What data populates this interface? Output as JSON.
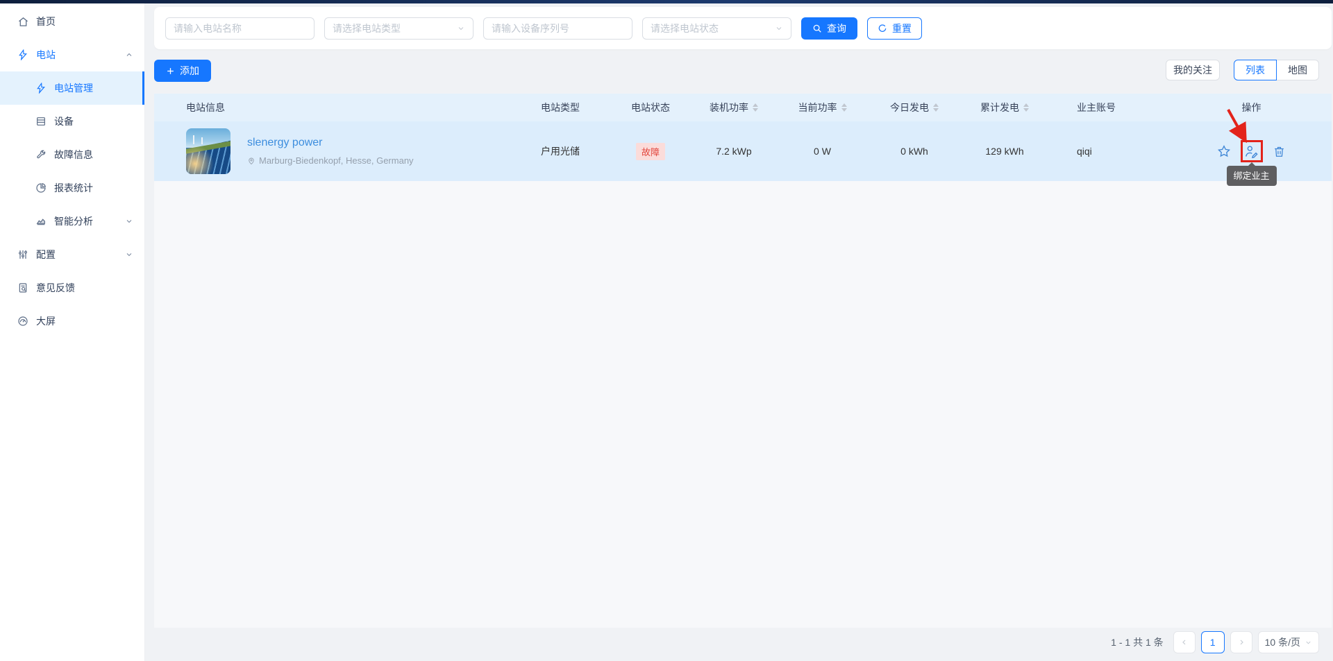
{
  "sidebar": {
    "items": [
      {
        "label": "首页"
      },
      {
        "label": "电站"
      },
      {
        "label": "电站管理"
      },
      {
        "label": "设备"
      },
      {
        "label": "故障信息"
      },
      {
        "label": "报表统计"
      },
      {
        "label": "智能分析"
      },
      {
        "label": "配置"
      },
      {
        "label": "意见反馈"
      },
      {
        "label": "大屏"
      }
    ]
  },
  "filters": {
    "station_name_placeholder": "请输入电站名称",
    "station_type_placeholder": "请选择电站类型",
    "device_sn_placeholder": "请输入设备序列号",
    "station_status_placeholder": "请选择电站状态",
    "search_label": "查询",
    "reset_label": "重置"
  },
  "toolbar": {
    "add_label": "添加",
    "my_follow_label": "我的关注",
    "list_label": "列表",
    "map_label": "地图"
  },
  "table": {
    "columns": [
      "电站信息",
      "电站类型",
      "电站状态",
      "装机功率",
      "当前功率",
      "今日发电",
      "累计发电",
      "业主账号",
      "操作"
    ],
    "row": {
      "name": "slenergy power",
      "location": "Marburg-Biedenkopf, Hesse, Germany",
      "type": "户用光储",
      "status": "故障",
      "installed_power": "7.2 kWp",
      "current_power": "0 W",
      "today_energy": "0 kWh",
      "total_energy": "129 kWh",
      "owner_account": "qiqi"
    }
  },
  "tooltip": {
    "bind_owner": "绑定业主"
  },
  "pagination": {
    "total_text": "1 - 1 共 1 条",
    "current_page": "1",
    "page_size": "10 条/页"
  },
  "colors": {
    "primary": "#1677ff",
    "fault_text": "#e2453c",
    "fault_bg": "#fbdcda",
    "annotation_red": "#e3231b",
    "header_bg": "#e4f1fc",
    "row_bg": "#dcedfc",
    "topbar": "#16294d"
  }
}
